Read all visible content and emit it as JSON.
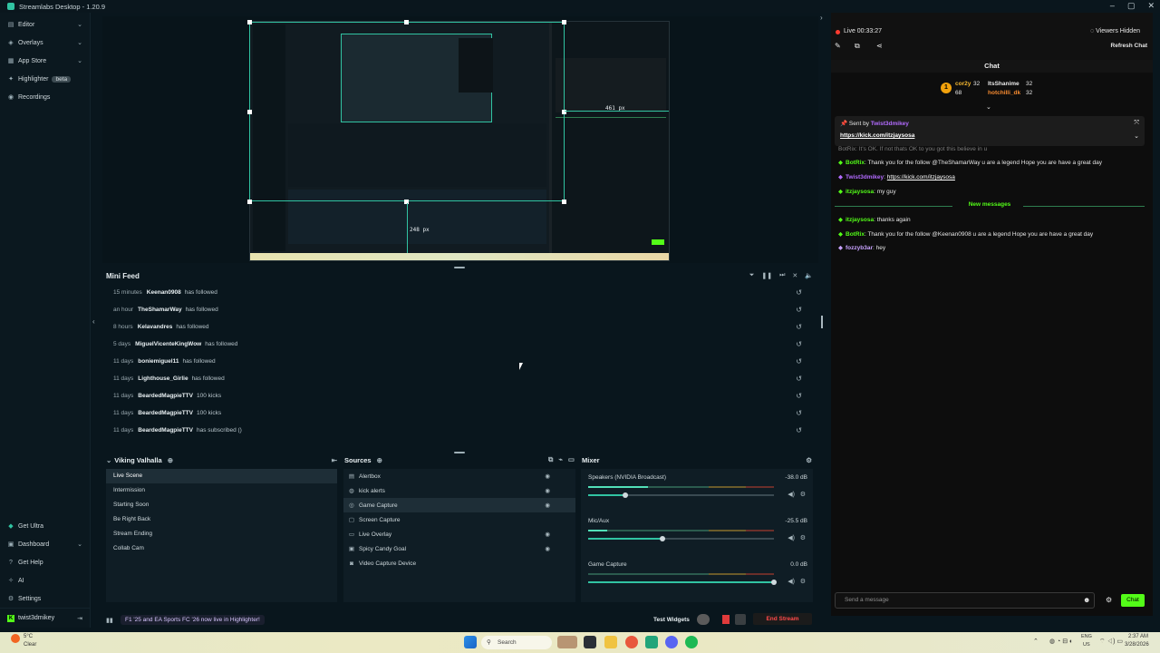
{
  "window": {
    "title": "Streamlabs Desktop - 1.20.9"
  },
  "sidebar": {
    "items": [
      {
        "label": "Editor",
        "icon": "editor-icon",
        "chevron": "⌄"
      },
      {
        "label": "Overlays",
        "icon": "overlays-icon",
        "chevron": "⌄"
      },
      {
        "label": "App Store",
        "icon": "app-store-icon",
        "chevron": "⌄"
      },
      {
        "label": "Highlighter",
        "icon": "highlighter-icon",
        "badge": "beta"
      },
      {
        "label": "Recordings",
        "icon": "recordings-icon"
      }
    ],
    "bottom_items": [
      {
        "label": "Get Ultra"
      },
      {
        "label": "Dashboard",
        "chevron": "⌄"
      },
      {
        "label": "Get Help"
      },
      {
        "label": "AI"
      },
      {
        "label": "Settings"
      }
    ],
    "user": "twist3dmikey"
  },
  "preview": {
    "width_label": "248 px",
    "height_label": "461 px"
  },
  "minifeed": {
    "title": "Mini Feed",
    "rows": [
      {
        "time": "15 minutes",
        "user": "Keenan0908",
        "action": "has followed"
      },
      {
        "time": "an hour",
        "user": "TheShamarWay",
        "action": "has followed"
      },
      {
        "time": "8 hours",
        "user": "Kelavandres",
        "action": "has followed"
      },
      {
        "time": "5 days",
        "user": "MiguelVicenteKingWow",
        "action": "has followed"
      },
      {
        "time": "11 days",
        "user": "boniemiguel11",
        "action": "has followed"
      },
      {
        "time": "11 days",
        "user": "Lighthouse_Girlie",
        "action": "has followed"
      },
      {
        "time": "11 days",
        "user": "BeardedMagpieTTV",
        "action": "100 kicks"
      },
      {
        "time": "11 days",
        "user": "BeardedMagpieTTV",
        "action": "100 kicks"
      },
      {
        "time": "11 days",
        "user": "BeardedMagpieTTV",
        "action": "has subscribed ()"
      }
    ]
  },
  "scenes": {
    "title": "Viking Valhalla",
    "items": [
      "Live Scene",
      "Intermission",
      "Starting Soon",
      "Be Right Back",
      "Stream Ending",
      "Collab Cam"
    ],
    "active_index": 0
  },
  "sources": {
    "title": "Sources",
    "items": [
      {
        "label": "Alertbox",
        "icon": "alertbox-icon",
        "visible": true
      },
      {
        "label": "kick alerts",
        "icon": "browser-icon",
        "visible": true
      },
      {
        "label": "Game Capture",
        "icon": "game-capture-icon",
        "visible": true
      },
      {
        "label": "Screen Capture",
        "icon": "screen-capture-icon",
        "visible": false
      },
      {
        "label": "Live Overlay",
        "icon": "folder-icon",
        "visible": true
      },
      {
        "label": "Spicy Candy Goal",
        "icon": "goal-icon",
        "visible": true
      },
      {
        "label": "Video Capture Device",
        "icon": "camera-icon",
        "visible": false
      }
    ],
    "active_index": 2
  },
  "mixer": {
    "title": "Mixer",
    "channels": [
      {
        "name": "Speakers (NVIDIA Broadcast)",
        "db": "-38.0 dB",
        "level": 0.32,
        "volume": 0.2
      },
      {
        "name": "Mic/Aux",
        "db": "-25.5 dB",
        "level": 0.1,
        "volume": 0.4
      },
      {
        "name": "Game Capture",
        "db": "0.0 dB",
        "level": 0,
        "volume": 1.0
      }
    ]
  },
  "footer": {
    "promo": "F1 '25 and EA Sports FC '26 now live in Highlighter!",
    "test_widgets": "Test Widgets",
    "end_stream": "End Stream"
  },
  "chat": {
    "live_time": "Live 00:33:27",
    "viewers": "Viewers Hidden",
    "refresh": "Refresh Chat",
    "title": "Chat",
    "leaders": [
      {
        "name": "cor2y",
        "count": "32"
      },
      {
        "name": "68",
        "count": ""
      },
      {
        "name": "ItsShanime",
        "count": "32"
      },
      {
        "name": "hotchilli_dk",
        "count": "32"
      }
    ],
    "pinned": {
      "label": "Sent by",
      "user": "Twist3dmikey",
      "link": "https://kick.com/itzjaysosa"
    },
    "cut_message": "BotRix: It's OK. If not thats OK to you got this believe in u",
    "messages": [
      {
        "user": "BotRix",
        "text": "Thank you for the follow @TheShamarWay u are a legend Hope you are have a great day",
        "color": "#53fc18"
      },
      {
        "user": "Twist3dmikey",
        "text": "https://kick.com/itzjaysosa",
        "color": "#b36bff",
        "link": true
      },
      {
        "user": "itzjaysosa",
        "text": "my guy",
        "color": "#53fc18"
      }
    ],
    "new_messages_label": "New messages",
    "messages_after": [
      {
        "user": "itzjaysosa",
        "text": "thanks again",
        "color": "#53fc18"
      },
      {
        "user": "BotRix",
        "text": "Thank you for the follow @Keenan0908 u are a legend Hope you are have a great day",
        "color": "#53fc18"
      },
      {
        "user": "fozzyb3ar",
        "text": "hey",
        "color": "#c8a2ff"
      }
    ],
    "input_placeholder": "Send a message",
    "send_label": "Chat"
  },
  "taskbar": {
    "weather_temp": "5°C",
    "weather_desc": "Clear",
    "search": "Search",
    "lang": "ENG",
    "region": "US",
    "time": "2:37 AM",
    "date": "3/28/2026"
  }
}
